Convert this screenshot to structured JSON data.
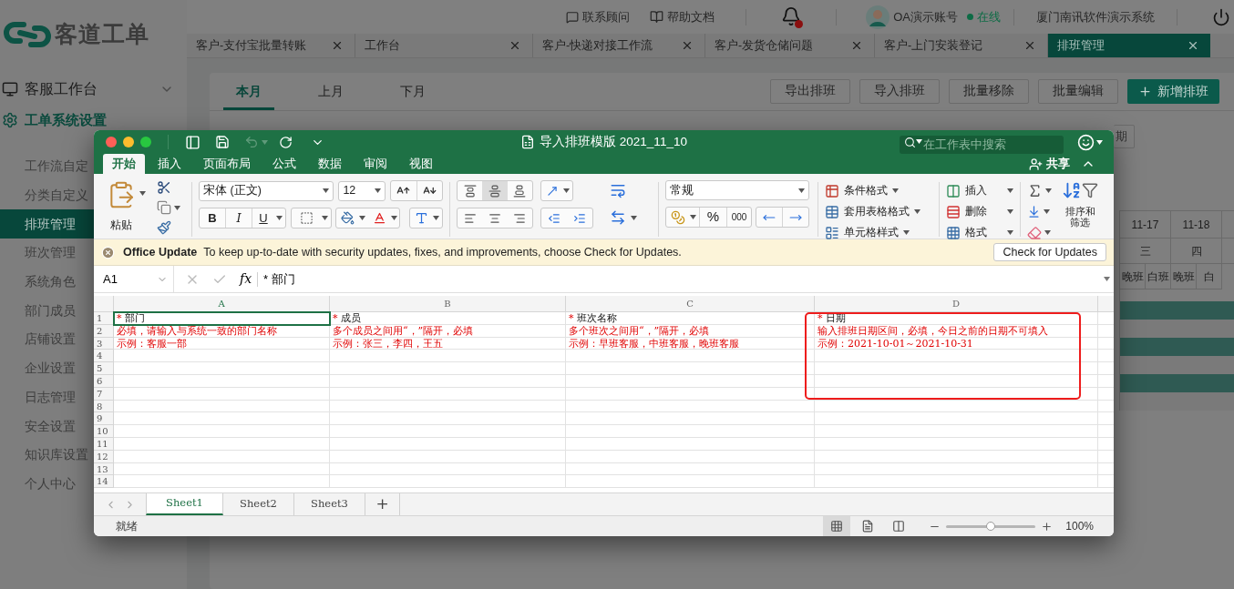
{
  "app": {
    "logo": "客道工单"
  },
  "header": {
    "links": [
      {
        "label": "联系顾问",
        "kind": "chat"
      },
      {
        "label": "帮助文档",
        "kind": "book"
      }
    ],
    "notifications": {
      "unread": true
    },
    "user": {
      "name": "OA演示账号",
      "status": "在线",
      "online": true
    },
    "company": "厦门南讯软件演示系统"
  },
  "tabs": [
    {
      "label": "客户-支付宝批量转账",
      "selected": false
    },
    {
      "label": "工作台",
      "selected": false
    },
    {
      "label": "客户-快递对接工作流",
      "selected": false
    },
    {
      "label": "客户-发货仓储问题",
      "selected": false
    },
    {
      "label": "客户-上门安装登记",
      "selected": false
    },
    {
      "label": "排班管理",
      "selected": true
    }
  ],
  "sidebar": {
    "groups": [
      {
        "label": "客服工作台",
        "kind": "monitor",
        "expanded": false
      },
      {
        "label": "工单系统设置",
        "kind": "settings",
        "children": [
          {
            "label": "工作流自定",
            "selected": false
          },
          {
            "label": "分类自定义",
            "selected": false
          },
          {
            "label": "排班管理",
            "selected": true
          },
          {
            "label": "班次管理",
            "selected": false
          },
          {
            "label": "系统角色",
            "selected": false
          },
          {
            "label": "部门成员",
            "selected": false
          },
          {
            "label": "店铺设置",
            "selected": false
          },
          {
            "label": "企业设置",
            "selected": false
          },
          {
            "label": "日志管理",
            "selected": false
          },
          {
            "label": "安全设置",
            "selected": false
          },
          {
            "label": "知识库设置",
            "selected": false
          },
          {
            "label": "个人中心",
            "selected": false
          }
        ]
      }
    ]
  },
  "page": {
    "period_tabs": [
      {
        "label": "本月",
        "selected": true
      },
      {
        "label": "上月",
        "selected": false
      },
      {
        "label": "下月",
        "selected": false
      }
    ],
    "actions": [
      {
        "label": "导出排班",
        "kind": "default"
      },
      {
        "label": "导入排班",
        "kind": "default"
      },
      {
        "label": "批量移除",
        "kind": "default"
      },
      {
        "label": "批量编辑",
        "kind": "default"
      },
      {
        "label": "新增排班",
        "kind": "primary"
      }
    ],
    "filter_button": "期",
    "schedule_table": {
      "dates": [
        "11-17",
        "11-18"
      ],
      "weekdays": [
        "三",
        "四"
      ],
      "shifts": [
        "晚班",
        "白班",
        "晚班",
        "白"
      ]
    }
  },
  "excel": {
    "title": "导入排班模版 2021_11_10",
    "search": {
      "placeholder": "在工作表中搜索"
    },
    "share": "共享",
    "ribbon_tabs": [
      {
        "label": "开始",
        "selected": true
      },
      {
        "label": "插入",
        "selected": false
      },
      {
        "label": "页面布局",
        "selected": false
      },
      {
        "label": "公式",
        "selected": false
      },
      {
        "label": "数据",
        "selected": false
      },
      {
        "label": "审阅",
        "selected": false
      },
      {
        "label": "视图",
        "selected": false
      }
    ],
    "ribbon": {
      "paste": "粘贴",
      "font": "宋体 (正文)",
      "font_size": "12",
      "bold": "B",
      "italic": "I",
      "underline": "U",
      "vertical_align": [
        {
          "kind": "top",
          "selected": false
        },
        {
          "kind": "middle",
          "selected": true
        },
        {
          "kind": "bottom",
          "selected": false
        }
      ],
      "number_format": "常规",
      "percent": "%",
      "thousands": "000",
      "styles": [
        "条件格式",
        "套用表格格式",
        "单元格样式"
      ],
      "cells": [
        "插入",
        "删除",
        "格式"
      ],
      "sort_filter": "排序和筛选"
    },
    "update_bar": {
      "title": "Office Update",
      "message": "To keep up-to-date with security updates, fixes, and improvements, choose Check for Updates.",
      "button": "Check for Updates"
    },
    "formula_bar": {
      "name_box": "A1",
      "fx": "fx",
      "formula": "* 部门"
    },
    "sheet": {
      "columns": [
        "A",
        "B",
        "C",
        "D"
      ],
      "rows": [
        {
          "number": "1",
          "cells": [
            {
              "kind": "header",
              "mark": "*",
              "text": "部门",
              "selected": true
            },
            {
              "kind": "header",
              "mark": "*",
              "text": "成员",
              "selected": false
            },
            {
              "kind": "header",
              "mark": "*",
              "text": "班次名称",
              "selected": false
            },
            {
              "kind": "header",
              "mark": "*",
              "text": "日期",
              "selected": false
            }
          ]
        },
        {
          "number": "2",
          "cells": [
            {
              "kind": "hint",
              "text": "必填，请输入与系统一致的部门名称",
              "selected": false
            },
            {
              "kind": "hint",
              "text": "多个成员之间用“，”隔开，必填",
              "selected": false
            },
            {
              "kind": "hint",
              "text": "多个班次之间用“，”隔开，必填",
              "selected": false
            },
            {
              "kind": "hint",
              "text": "输入排班日期区间，必填，今日之前的日期不可填入",
              "selected": false
            }
          ]
        },
        {
          "number": "3",
          "cells": [
            {
              "kind": "hint",
              "text": "示例：客服一部",
              "selected": false
            },
            {
              "kind": "hint",
              "text": "示例：张三，李四，王五",
              "selected": false
            },
            {
              "kind": "hint",
              "text": "示例：早班客服，中班客服，晚班客服",
              "selected": false
            },
            {
              "kind": "hint",
              "text": "示例：2021-10-01～2021-10-31",
              "selected": false
            }
          ]
        },
        {
          "number": "4"
        },
        {
          "number": "5"
        },
        {
          "number": "6"
        },
        {
          "number": "7"
        },
        {
          "number": "8"
        },
        {
          "number": "9"
        },
        {
          "number": "10"
        },
        {
          "number": "11"
        },
        {
          "number": "12"
        },
        {
          "number": "13"
        },
        {
          "number": "14"
        }
      ]
    },
    "sheet_tabs": [
      {
        "label": "Sheet1",
        "selected": true
      },
      {
        "label": "Sheet2",
        "selected": false
      },
      {
        "label": "Sheet3",
        "selected": false
      }
    ],
    "add_sheet": "+",
    "status_bar": {
      "status": "就绪",
      "views": [
        {
          "kind": "normal",
          "selected": true
        },
        {
          "kind": "page_layout",
          "selected": false
        },
        {
          "kind": "page_break",
          "selected": false
        }
      ],
      "zoom": {
        "level": 0.5
      },
      "zoom_label": "100%"
    }
  }
}
